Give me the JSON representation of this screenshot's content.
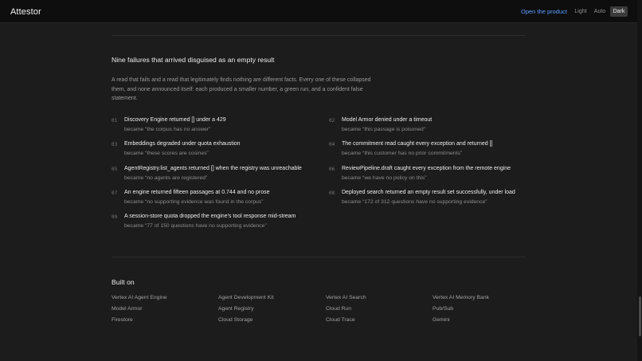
{
  "header": {
    "brand": "Attestor",
    "open_product": "Open the product",
    "theme": {
      "light": "Light",
      "auto": "Auto",
      "dark": "Dark",
      "selected": "Dark"
    }
  },
  "failures_section": {
    "heading": "Nine failures that arrived disguised as an empty result",
    "intro": "A read that fails and a read that legitimately finds nothing are different facts. Every one of these collapsed them, and none announced itself: each produced a smaller number, a green run, and a confident false statement.",
    "items": [
      {
        "num": "01",
        "title": "Discovery Engine returned [] under a 429",
        "became": "became “the corpus has no answer”"
      },
      {
        "num": "02",
        "title": "Model Armor denied under a timeout",
        "became": "became “this passage is poisoned”"
      },
      {
        "num": "03",
        "title": "Embeddings degraded under quota exhaustion",
        "became": "became “these scores are cosines”"
      },
      {
        "num": "04",
        "title": "The commitment read caught every exception and returned []",
        "became": "became “this customer has no prior commitments”"
      },
      {
        "num": "05",
        "title": "AgentRegistry.list_agents returned [] when the registry was unreachable",
        "became": "became “no agents are registered”"
      },
      {
        "num": "06",
        "title": "ReviewPipeline.draft caught every exception from the remote engine",
        "became": "became “we have no policy on this”"
      },
      {
        "num": "07",
        "title": "An engine returned fifteen passages at 0.744 and no prose",
        "became": "became “no supporting evidence was found in the corpus”"
      },
      {
        "num": "08",
        "title": "Deployed search returned an empty result set successfully, under load",
        "became": "became “172 of 312 questions have no supporting evidence”"
      },
      {
        "num": "09",
        "title": "A session-store quota dropped the engine's tool response mid-stream",
        "became": "became “77 of 150 questions have no supporting evidence”"
      }
    ]
  },
  "built_on": {
    "heading": "Built on",
    "items": [
      "Vertex AI Agent Engine",
      "Agent Development Kit",
      "Vertex AI Search",
      "Vertex AI Memory Bank",
      "Model Armor",
      "Agent Registry",
      "Cloud Run",
      "Pub/Sub",
      "Firestore",
      "Cloud Storage",
      "Cloud Trace",
      "Gemini"
    ]
  }
}
